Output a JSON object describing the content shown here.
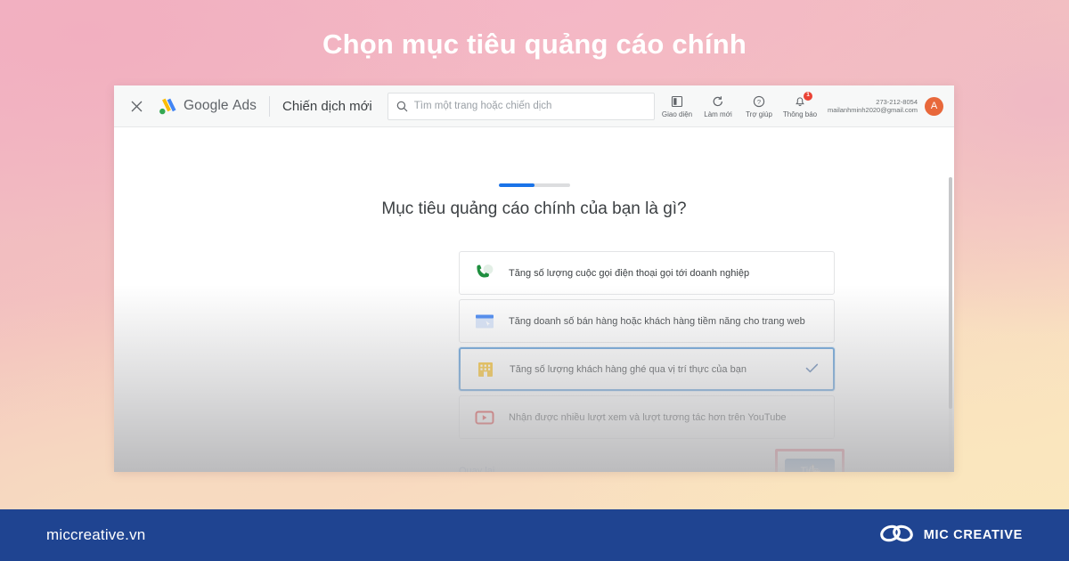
{
  "page": {
    "title": "Chọn mục tiêu quảng cáo chính",
    "accent_blue": "#1a73e8",
    "highlight_red": "#e8394f",
    "footer_blue": "#1f4491"
  },
  "app_header": {
    "close_icon": "close-icon",
    "brand_google": "Google",
    "brand_ads": "Ads",
    "campaign_title": "Chiến dịch mới",
    "search": {
      "icon": "search-icon",
      "placeholder": "Tìm một trang hoặc chiến dịch"
    },
    "tools": [
      {
        "icon": "appearance-icon",
        "label": "Giao diện",
        "badge": ""
      },
      {
        "icon": "refresh-icon",
        "label": "Làm mới",
        "badge": ""
      },
      {
        "icon": "help-icon",
        "label": "Trợ giúp",
        "badge": ""
      },
      {
        "icon": "bell-icon",
        "label": "Thông báo",
        "badge": "1"
      }
    ],
    "account": {
      "id": "273-212-8054",
      "email": "mailanhminh2020@gmail.com",
      "avatar_initial": "A"
    }
  },
  "wizard": {
    "progress_percent": 50,
    "question": "Mục tiêu quảng cáo chính của bạn là gì?",
    "options": [
      {
        "icon": "phone-call-icon",
        "label": "Tăng số lượng cuộc gọi điện thoại gọi tới doanh nghiệp",
        "selected": false
      },
      {
        "icon": "website-icon",
        "label": "Tăng doanh số bán hàng hoặc khách hàng tiềm năng cho trang web",
        "selected": false
      },
      {
        "icon": "store-icon",
        "label": "Tăng số lượng khách hàng ghé qua vị trí thực của bạn",
        "selected": true
      },
      {
        "icon": "youtube-icon",
        "label": "Nhận được nhiều lượt xem và lượt tương tác hơn trên YouTube",
        "selected": false
      }
    ],
    "check_icon": "check-icon",
    "back_label": "Quay lại",
    "next_label": "Tiếp"
  },
  "bottom_bar": {
    "site": "miccreative.vn",
    "logo_icon": "mic-infinity-logo-icon",
    "brand": "MIC CREATIVE"
  }
}
